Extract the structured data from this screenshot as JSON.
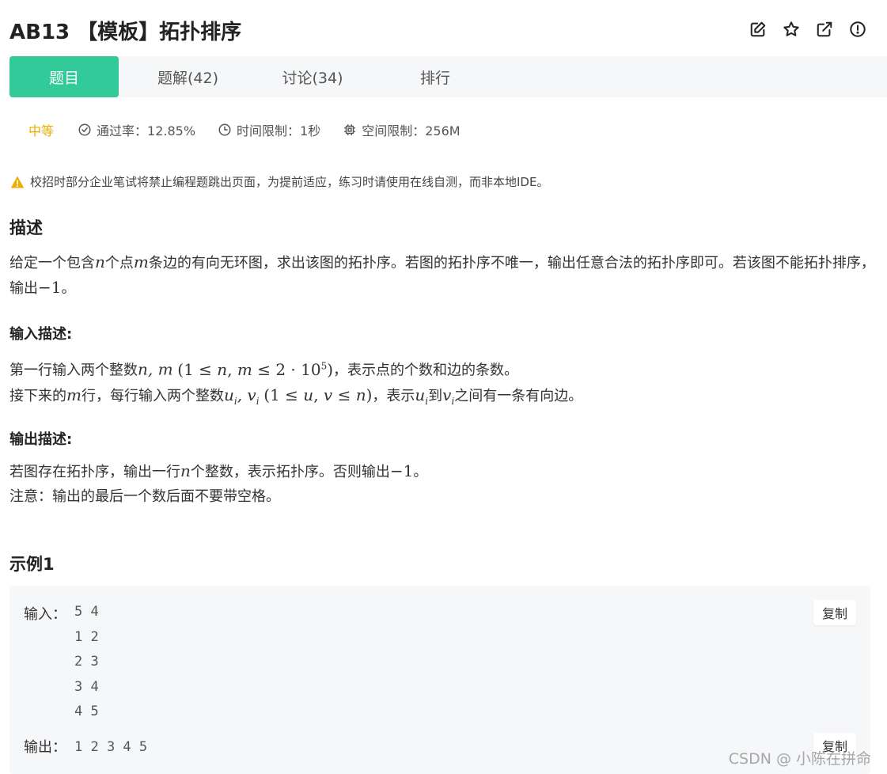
{
  "header": {
    "title": "AB13 【模板】拓扑排序",
    "icons": [
      "edit-icon",
      "star-icon",
      "open-external-icon",
      "report-icon"
    ]
  },
  "tabs": [
    {
      "label": "题目",
      "active": true
    },
    {
      "label": "题解(42)",
      "active": false
    },
    {
      "label": "讨论(34)",
      "active": false
    },
    {
      "label": "排行",
      "active": false
    }
  ],
  "meta": {
    "difficulty": "中等",
    "difficulty_color": "#f0ad00",
    "pass_rate": "通过率：12.85%",
    "time_limit": "时间限制：1秒",
    "space_limit": "空间限制：256M"
  },
  "warning": "校招时部分企业笔试将禁止编程题跳出页面，为提前适应，练习时请使用在线自测，而非本地IDE。",
  "description": {
    "heading": "描述",
    "p1a": "给定一个包含",
    "p1b": "个点",
    "p1c": "条边的有向无环图，求出该图的拓扑序。若图的拓扑序不唯一，输出任意合法的拓扑序即可。若该图不能拓扑排序，输出",
    "p1d": "。"
  },
  "input_desc": {
    "heading": "输入描述:",
    "l1a": "第一行输入两个整数",
    "l1b": "，表示点的个数和边的条数。",
    "l2a": "接下来的",
    "l2b": "行，每行输入两个整数",
    "l2c": "，表示",
    "l2d": "到",
    "l2e": "之间有一条有向边。"
  },
  "output_desc": {
    "heading": "输出描述:",
    "l1a": "若图存在拓扑序，输出一行",
    "l1b": "个整数，表示拓扑序。否则输出",
    "l1c": "。",
    "l2": "注意：输出的最后一个数后面不要带空格。"
  },
  "example": {
    "heading": "示例1",
    "input_label": "输入：",
    "input_lines": "5 4\n1 2\n2 3\n3 4\n4 5",
    "output_label": "输出：",
    "output_lines": "1 2 3 4 5",
    "copy_label": "复制"
  },
  "watermark": "CSDN @ 小陈在拼命",
  "colors": {
    "accent": "#32ca99",
    "tabbar_bg": "#f6f7f9",
    "warning": "#f0ad00"
  }
}
